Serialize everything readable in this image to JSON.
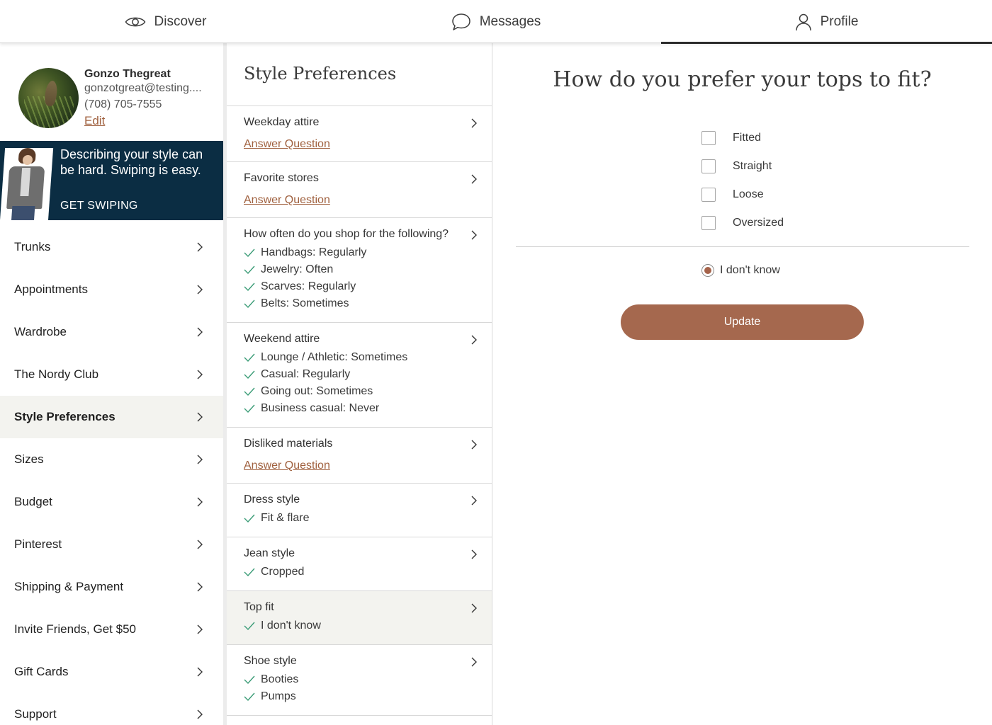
{
  "topnav": {
    "tabs": [
      {
        "label": "Discover",
        "icon": "eye-icon"
      },
      {
        "label": "Messages",
        "icon": "chat-bubble-icon"
      },
      {
        "label": "Profile",
        "icon": "person-icon",
        "active": true
      }
    ]
  },
  "profile": {
    "name": "Gonzo Thegreat",
    "email": "gonzotgreat@testing....",
    "phone": "(708) 705-7555",
    "edit_label": "Edit"
  },
  "promo": {
    "text": "Describing your style can be hard. Swiping is easy.",
    "cta": "GET SWIPING"
  },
  "menu": {
    "items": [
      {
        "label": "Trunks"
      },
      {
        "label": "Appointments"
      },
      {
        "label": "Wardrobe"
      },
      {
        "label": "The Nordy Club"
      },
      {
        "label": "Style Preferences",
        "active": true
      },
      {
        "label": "Sizes"
      },
      {
        "label": "Budget"
      },
      {
        "label": "Pinterest"
      },
      {
        "label": "Shipping & Payment"
      },
      {
        "label": "Invite Friends, Get $50"
      },
      {
        "label": "Gift Cards"
      },
      {
        "label": "Support"
      }
    ]
  },
  "style_prefs": {
    "title": "Style Preferences",
    "answer_link": "Answer Question",
    "items": [
      {
        "title": "Weekday attire",
        "answers": []
      },
      {
        "title": "Favorite stores",
        "answers": []
      },
      {
        "title": "How often do you shop for the following?",
        "answers": [
          "Handbags: Regularly",
          "Jewelry: Often",
          "Scarves: Regularly",
          "Belts: Sometimes"
        ]
      },
      {
        "title": "Weekend attire",
        "answers": [
          "Lounge / Athletic: Sometimes",
          "Casual: Regularly",
          "Going out: Sometimes",
          "Business casual: Never"
        ]
      },
      {
        "title": "Disliked materials",
        "answers": []
      },
      {
        "title": "Dress style",
        "answers": [
          "Fit & flare"
        ]
      },
      {
        "title": "Jean style",
        "answers": [
          "Cropped"
        ]
      },
      {
        "title": "Top fit",
        "answers": [
          "I don't know"
        ],
        "active": true
      },
      {
        "title": "Shoe style",
        "answers": [
          "Booties",
          "Pumps"
        ]
      }
    ]
  },
  "question": {
    "title": "How do you prefer your tops to fit?",
    "options": [
      "Fitted",
      "Straight",
      "Loose",
      "Oversized"
    ],
    "dont_know": "I don't know",
    "dont_know_selected": true,
    "update_label": "Update"
  },
  "colors": {
    "accent": "#a5684e",
    "link": "#a0613f",
    "promo_bg": "#0b2d43",
    "check": "#3b9c77",
    "active_bg": "#f3f3ef"
  }
}
